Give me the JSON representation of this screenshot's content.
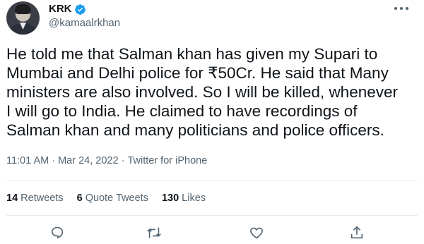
{
  "author": {
    "display_name": "KRK",
    "handle": "@kamaalrkhan",
    "verified_icon": "verified-badge-icon",
    "avatar": "profile-photo"
  },
  "tweet": {
    "text": "He told me that Salman khan has given my Supari to\nMumbai and Delhi police for ₹50Cr. He said that Many\nministers are also involved. So I will be killed, whenever\nI will go to India. He claimed to have recordings of\nSalman khan and many politicians and police officers.",
    "time": "11:01 AM",
    "date": "Mar 24, 2022",
    "source": "Twitter for iPhone"
  },
  "stats": {
    "retweets_count": "14",
    "retweets_label": "Retweets",
    "quotes_count": "6",
    "quotes_label": "Quote Tweets",
    "likes_count": "130",
    "likes_label": "Likes"
  },
  "actions": [
    "reply-icon",
    "retweet-icon",
    "like-icon",
    "share-icon"
  ],
  "colors": {
    "text": "#0f1419",
    "secondary": "#536471",
    "verified": "#1d9bf0",
    "divider": "#e6ecf0"
  }
}
